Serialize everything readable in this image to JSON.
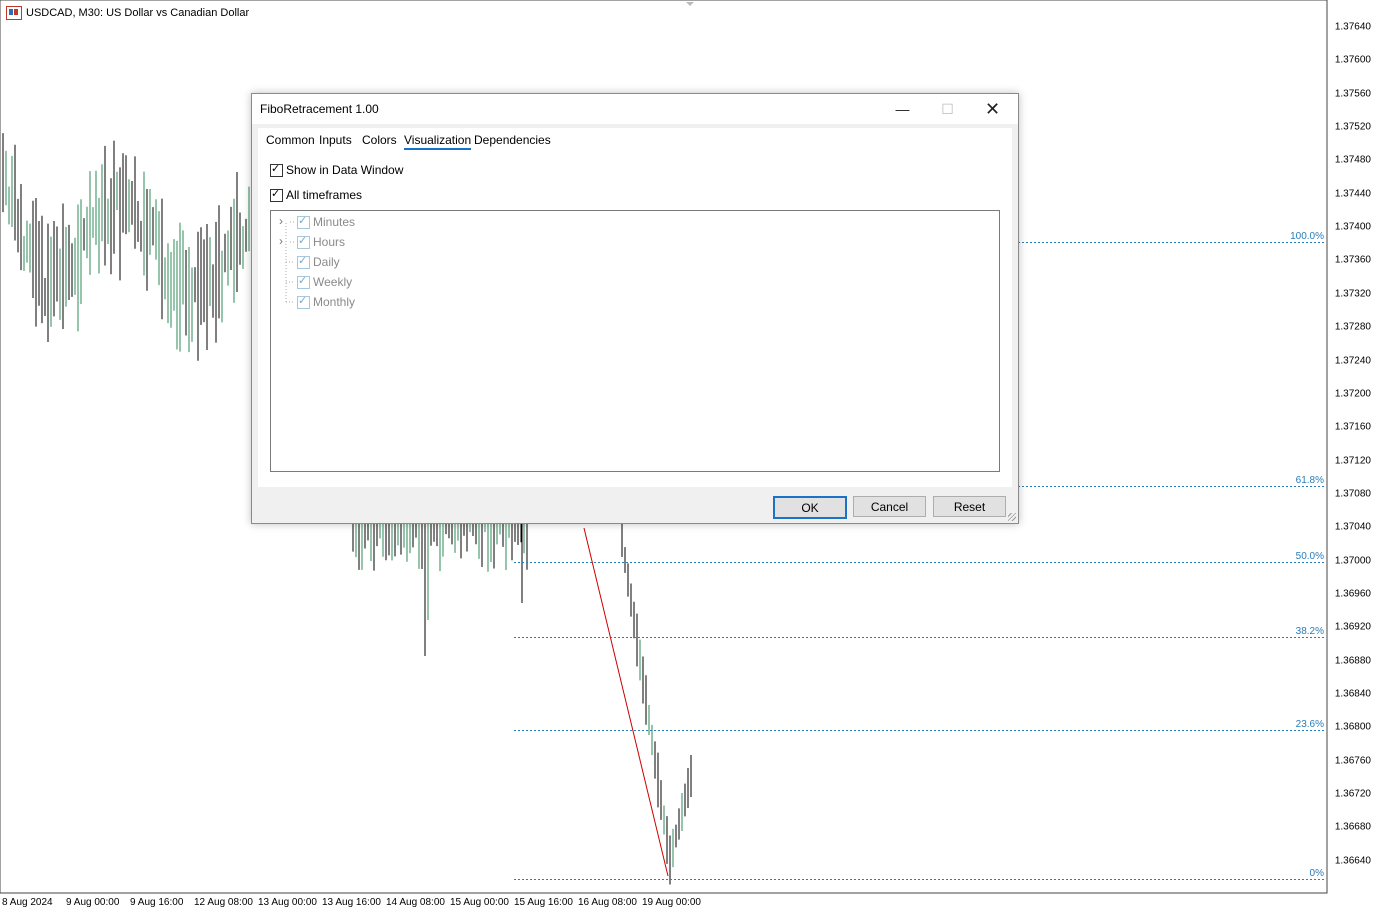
{
  "chart": {
    "symbol_title": "USDCAD, M30:  US Dollar vs Canadian Dollar",
    "price_labels": [
      "1.37640",
      "1.37600",
      "1.37560",
      "1.37520",
      "1.37480",
      "1.37440",
      "1.37400",
      "1.37360",
      "1.37320",
      "1.37280",
      "1.37240",
      "1.37200",
      "1.37160",
      "1.37120",
      "1.37080",
      "1.37040",
      "1.37000",
      "1.36960",
      "1.36920",
      "1.36880",
      "1.36840",
      "1.36800",
      "1.36760",
      "1.36720",
      "1.36680",
      "1.36640"
    ],
    "time_labels": [
      "8 Aug 2024",
      "9 Aug 00:00",
      "9 Aug 16:00",
      "12 Aug 08:00",
      "13 Aug 00:00",
      "13 Aug 16:00",
      "14 Aug 08:00",
      "15 Aug 00:00",
      "15 Aug 16:00",
      "16 Aug 08:00",
      "19 Aug 00:00"
    ],
    "fib_levels": [
      {
        "label": "100.0%",
        "price": 1.37382
      },
      {
        "label": "61.8%",
        "price": 1.3709
      },
      {
        "label": "50.0%",
        "price": 1.36998
      },
      {
        "label": "38.2%",
        "price": 1.36908
      },
      {
        "label": "23.6%",
        "price": 1.36797
      },
      {
        "label": "0%",
        "price": 1.36618
      }
    ],
    "colors": {
      "fib": "#2a7cb8",
      "bull": "#2e8b57",
      "bear": "#000000",
      "trendline": "#cc0000"
    }
  },
  "dialog": {
    "title": "FiboRetracement 1.00",
    "tabs": [
      "Common",
      "Inputs",
      "Colors",
      "Visualization",
      "Dependencies"
    ],
    "active_tab": "Visualization",
    "show_in_data_window": "Show in Data Window",
    "all_timeframes": "All timeframes",
    "timeframes": [
      "Minutes",
      "Hours",
      "Daily",
      "Weekly",
      "Monthly"
    ],
    "buttons": {
      "ok": "OK",
      "cancel": "Cancel",
      "reset": "Reset"
    },
    "icons": {
      "minimize": "minimize-icon",
      "maximize": "maximize-icon",
      "close": "close-icon",
      "expand": "chevron-right-icon"
    }
  }
}
